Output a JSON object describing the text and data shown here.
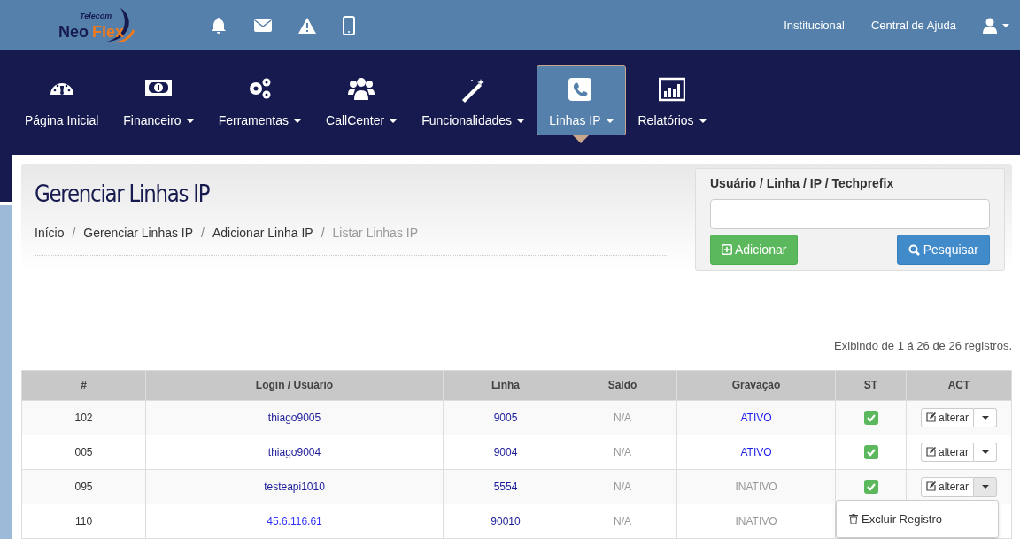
{
  "logo": {
    "brand_a": "Neo",
    "brand_b": "Flex",
    "tagline": "Telecom"
  },
  "top_links": [
    "Institucional",
    "Central de Ajuda"
  ],
  "nav": [
    {
      "label": "Página Inicial",
      "dropdown": false,
      "selected": false
    },
    {
      "label": "Financeiro",
      "dropdown": true,
      "selected": false
    },
    {
      "label": "Ferramentas",
      "dropdown": true,
      "selected": false
    },
    {
      "label": "CallCenter",
      "dropdown": true,
      "selected": false
    },
    {
      "label": "Funcionalidades",
      "dropdown": true,
      "selected": false
    },
    {
      "label": "Linhas IP",
      "dropdown": true,
      "selected": true
    },
    {
      "label": "Relatórios",
      "dropdown": true,
      "selected": false
    }
  ],
  "page_title": "Gerenciar Linhas IP",
  "breadcrumb_separator": "/",
  "breadcrumb": [
    {
      "label": "Início",
      "current": false
    },
    {
      "label": "Gerenciar Linhas IP",
      "current": false
    },
    {
      "label": "Adicionar Linha IP",
      "current": false
    },
    {
      "label": "Listar Linhas IP",
      "current": true
    }
  ],
  "search": {
    "label": "Usuário / Linha / IP / Techprefix",
    "add_button": "Adicionar",
    "search_button": "Pesquisar"
  },
  "summary": "Exibindo de 1 á 26 de 26 registros.",
  "table": {
    "columns": [
      "#",
      "Login / Usuário",
      "Linha",
      "Saldo",
      "Gravação",
      "ST",
      "ACT"
    ],
    "rows": [
      {
        "id": "102",
        "login": "thiago9005",
        "kind": "user",
        "linha": "9005",
        "saldo": "N/A",
        "gravacao": "ATIVO",
        "recording": true,
        "st_checked": true,
        "action": "alterar",
        "menu_open": false
      },
      {
        "id": "005",
        "login": "thiago9004",
        "kind": "user",
        "linha": "9004",
        "saldo": "N/A",
        "gravacao": "ATIVO",
        "recording": true,
        "st_checked": true,
        "action": "alterar",
        "menu_open": false
      },
      {
        "id": "095",
        "login": "testeapi1010",
        "kind": "user",
        "linha": "5554",
        "saldo": "N/A",
        "gravacao": "INATIVO",
        "recording": false,
        "st_checked": true,
        "action": "alterar",
        "menu_open": true
      },
      {
        "id": "110",
        "login": "45.6.116.61",
        "kind": "ip",
        "linha": "90010",
        "saldo": "N/A",
        "gravacao": "INATIVO",
        "recording": false
      }
    ]
  },
  "row_menu": [
    "Excluir Registro"
  ]
}
